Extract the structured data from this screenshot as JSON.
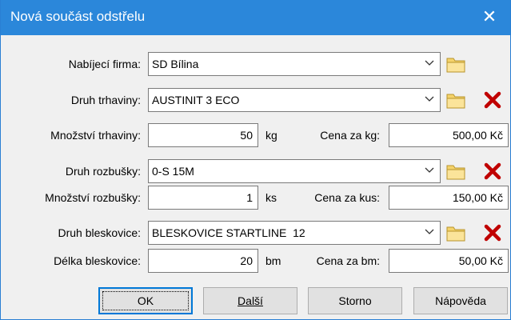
{
  "window": {
    "title": "Nová součást odstřelu"
  },
  "form": {
    "firm": {
      "label": "Nabíjecí firma:",
      "value": "SD Bílina"
    },
    "explosive_type": {
      "label": "Druh trhaviny:",
      "value": "AUSTINIT 3 ECO"
    },
    "explosive_qty": {
      "label": "Množství trhaviny:",
      "value": "50",
      "unit": "kg",
      "price_label": "Cena za kg:",
      "price": "500,00 Kč"
    },
    "detonator_type": {
      "label": "Druh rozbušky:",
      "value": "0-S 15M"
    },
    "detonator_qty": {
      "label": "Množství rozbušky:",
      "value": "1",
      "unit": "ks",
      "price_label": "Cena za kus:",
      "price": "150,00 Kč"
    },
    "fuse_type": {
      "label": "Druh bleskovice:",
      "value": "BLESKOVICE STARTLINE  12"
    },
    "fuse_length": {
      "label": "Délka bleskovice:",
      "value": "20",
      "unit": "bm",
      "price_label": "Cena za bm:",
      "price": "50,00 Kč"
    }
  },
  "buttons": {
    "ok": "OK",
    "next": "Další",
    "cancel": "Storno",
    "help": "Nápověda"
  },
  "icons": {
    "folder": "folder-icon",
    "delete": "delete-x-icon",
    "dropdown": "chevron-down-icon",
    "close": "close-icon"
  },
  "colors": {
    "titlebar": "#2b87da",
    "delete": "#c00000",
    "folder": "#f5d36b"
  }
}
